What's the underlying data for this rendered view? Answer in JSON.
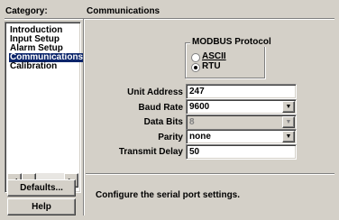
{
  "category_header": "Category:",
  "section_header": "Communications",
  "categories": [
    {
      "label": "Introduction"
    },
    {
      "label": "Input Setup"
    },
    {
      "label": "Alarm Setup"
    },
    {
      "label": "Communications"
    },
    {
      "label": "Calibration"
    }
  ],
  "selected_category": "Communications",
  "modbus": {
    "title": "MODBUS Protocol",
    "options": [
      {
        "label": "ASCII",
        "selected": false
      },
      {
        "label": "RTU",
        "selected": true
      }
    ]
  },
  "fields": {
    "unit_address": {
      "label": "Unit Address",
      "value": "247"
    },
    "baud_rate": {
      "label": "Baud Rate",
      "value": "9600"
    },
    "data_bits": {
      "label": "Data Bits",
      "value": "8"
    },
    "parity": {
      "label": "Parity",
      "value": "none"
    },
    "transmit_delay": {
      "label": "Transmit Delay",
      "value": "50"
    }
  },
  "buttons": {
    "defaults": "Defaults...",
    "help": "Help"
  },
  "description": "Configure the serial port settings.",
  "icons": {
    "scroll_left": "triangle-left",
    "scroll_right": "triangle-right",
    "combo": "triangle-down"
  },
  "colors": {
    "face": "#d4d0c8",
    "selection": "#0a246a"
  }
}
